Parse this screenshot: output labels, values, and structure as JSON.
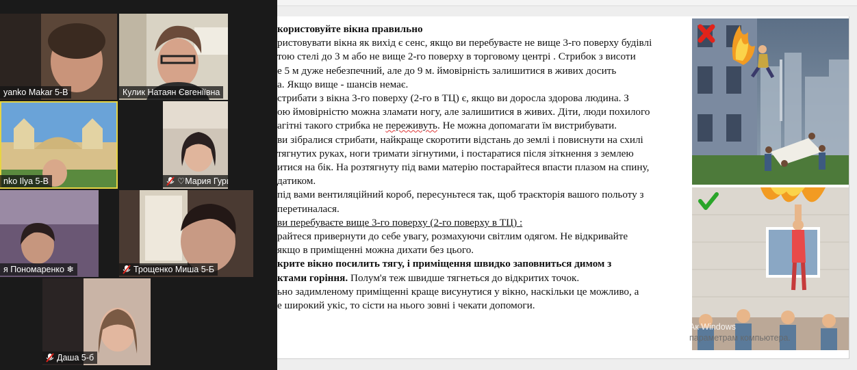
{
  "participants": [
    {
      "name": "yanko Makar 5-В",
      "muted": false
    },
    {
      "name": "Кулик Натаян Євгеніївна",
      "muted": false
    },
    {
      "name": "nko Ilya 5-В",
      "muted": false
    },
    {
      "name": "♡Мария Гурий♡",
      "muted": true
    },
    {
      "name": "я Пономаренко ❄",
      "muted": false
    },
    {
      "name": "Трощенко Миша 5-Б",
      "muted": true
    },
    {
      "name": "Даша 5-б",
      "muted": true
    }
  ],
  "slide": {
    "lines": [
      {
        "text": "користовуйте вікна правильно",
        "bold": true
      },
      {
        "text": "ристовувати вікна як вихід є сенс, якщо ви перебуваєте не вище 3-го поверху будівлі"
      },
      {
        "text": "тою стелі до 3 м або не вище 2-го поверху в торговому центрі . Стрибок з висоти"
      },
      {
        "text": "е 5 м дуже небезпечний, але до 9 м. ймовірність залишитися в живих досить"
      },
      {
        "text": "а. Якщо вище - шансів немає."
      },
      {
        "text": "стрибати з вікна 3-го поверху (2-го в ТЦ) є, якщо ви доросла здорова людина. З"
      },
      {
        "text": "ою ймовірністю можна зламати ногу, але залишитися в живих. Діти, люди похилого"
      },
      {
        "text": "агітні такого стрибка не переживуть. Не можна допомагати їм вистрибувати."
      },
      {
        "text": "ви зібралися стрибати, найкраще скоротити відстань до землі і повиснути на схилі"
      },
      {
        "text": "тягнутих руках, ноги тримати зігнутими, і постаратися після зіткнення з землею"
      },
      {
        "text": "итися на бік. На розтягнуту під вами матерію постарайтеся впасти плазом на спину,"
      },
      {
        "text": "датиком."
      },
      {
        "text": "під вами вентиляційний короб, пересуньтеся так, щоб траєкторія вашого польоту з"
      },
      {
        "text": "перетиналася."
      },
      {
        "text": "ви перебуваєте вище 3-го поверху (2-го поверху в ТЦ) :",
        "underline": true
      },
      {
        "text": "райтеся привернути до себе увагу, розмахуючи світлим одягом. Не відкривайте"
      },
      {
        "text": "якщо в приміщенні можна дихати без цього."
      },
      {
        "text": "крите вікно посилить тягу, і приміщення швидко заповниться димом з",
        "bold": true
      },
      {
        "text_bold": "ктами горіння.",
        "text_rest": " Полум'я теж швидше тягнеться до відкритих точок."
      },
      {
        "text": "ьно задимленому приміщенні краще висунутися у вікно, наскільки це можливо, а"
      },
      {
        "text": "е широкий укіс, то сісти на нього зовні і чекати допомоги."
      }
    ],
    "spellcheck_word": "переживуть"
  },
  "watermark": {
    "line1": "Ак      Windows",
    "line2": "параметрам компьютера."
  },
  "colors": {
    "cross": "#e2231a",
    "check": "#2aa52a",
    "active_speaker": "#e7d443"
  }
}
